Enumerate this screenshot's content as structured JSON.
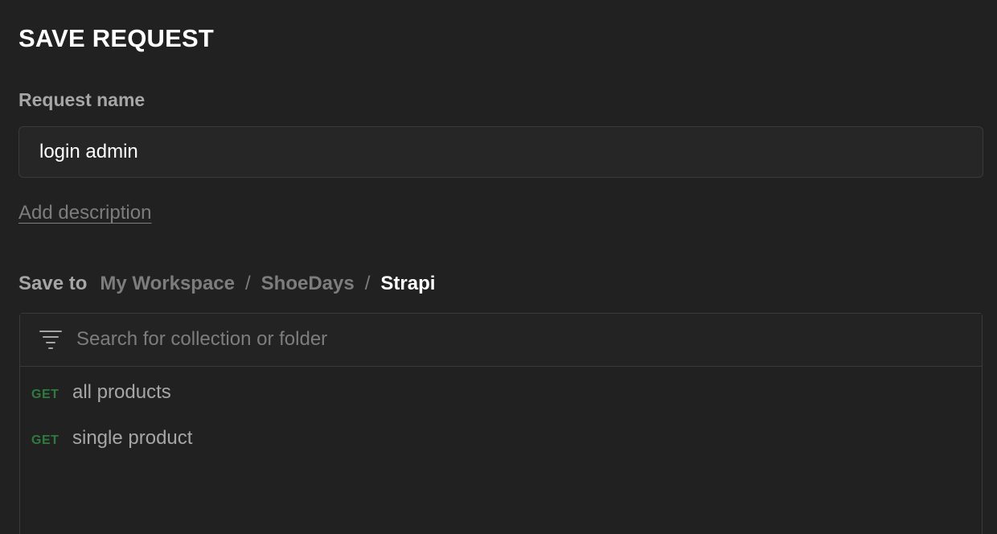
{
  "dialog": {
    "title": "SAVE REQUEST",
    "request_name_label": "Request name",
    "request_name_value": "login admin",
    "add_description": "Add description"
  },
  "save_to": {
    "label": "Save to",
    "breadcrumb": [
      "My Workspace",
      "ShoeDays",
      "Strapi"
    ],
    "separator": "/"
  },
  "browser": {
    "search_placeholder": "Search for collection or folder",
    "items": [
      {
        "method": "GET",
        "name": "all products"
      },
      {
        "method": "GET",
        "name": "single product"
      }
    ]
  },
  "colors": {
    "background": "#212121",
    "method_get": "#2f7a3e",
    "muted_text": "#7d7d7d",
    "label_text": "#a6a6a6"
  },
  "icons": {
    "filter": "filter-icon"
  }
}
